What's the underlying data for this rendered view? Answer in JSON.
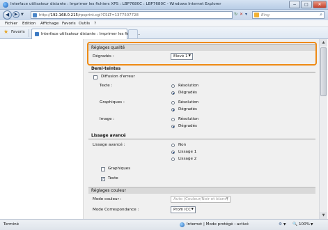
{
  "window": {
    "title": "Interface utilisateur distante : Imprimer les fichiers XPS : LBP7680C : LBP7680C - Windows Internet Explorer",
    "controls": {
      "minimize": "−",
      "maximize": "□",
      "close": "✕"
    }
  },
  "addressbar": {
    "url_prefix": "http://",
    "url_host": "192.168.0.215",
    "url_path": "/rpsprint.cgi?CSLT=1377507728",
    "search_placeholder": "Bing"
  },
  "menu": [
    "Fichier",
    "Edition",
    "Affichage",
    "Favoris",
    "Outils",
    "?"
  ],
  "favorites": {
    "label": "Favoris",
    "tab_title": "Interface utilisateur distante : Imprimer les fichier..."
  },
  "sections": {
    "quality": "Réglages qualité",
    "halftones": "Demi-teintes",
    "advanced_smoothing": "Lissage avancé",
    "color": "Réglages couleur"
  },
  "quality": {
    "gradations_label": "Dégradés :",
    "gradations_value": "Elevé 1"
  },
  "halftones": {
    "error_diffusion_label": "Diffusion d'erreur",
    "text_label": "Texte :",
    "graphics_label": "Graphiques :",
    "image_label": "Image :",
    "option_resolution": "Résolution",
    "option_gradations": "Dégradés"
  },
  "smoothing": {
    "label": "Lissage avancé :",
    "options": [
      "Non",
      "Lissage 1",
      "Lissage 2"
    ],
    "graphics_label": "Graphiques",
    "text_label": "Texte"
  },
  "color": {
    "mode_label": "Mode couleur :",
    "mode_value": "Auto (Couleur/Noir et blanc)",
    "matching_label": "Mode Correspondance :",
    "matching_value": "Profil ICC"
  },
  "status": {
    "left": "Terminé",
    "zone": "Internet | Mode protégé : activé",
    "zoom": "100%"
  }
}
